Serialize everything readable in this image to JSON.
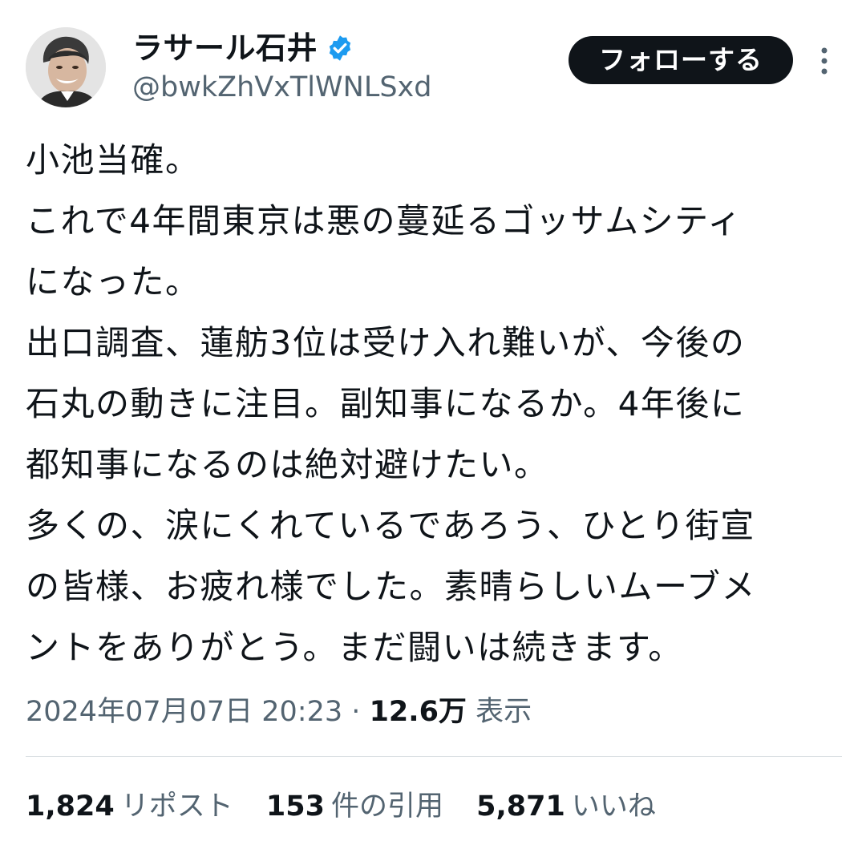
{
  "author": {
    "display_name": "ラサール石井",
    "handle": "@bwkZhVxTlWNLSxd",
    "verified_color": "#1d9bf0"
  },
  "actions": {
    "follow_label": "フォローする"
  },
  "tweet": {
    "lines": [
      "小池当確。",
      "これで4年間東京は悪の蔓延るゴッサムシティ",
      "になった。",
      "出口調査、蓮舫3位は受け入れ難いが、今後の",
      "石丸の動きに注目。副知事になるか。4年後に",
      "都知事になるのは絶対避けたい。",
      "多くの、涙にくれているであろう、ひとり街宣",
      "の皆様、お疲れ様でした。素晴らしいムーブメ",
      "ントをありがとう。まだ闘いは続きます。"
    ]
  },
  "meta": {
    "timestamp": "2024年07月07日 20:23",
    "separator": "·",
    "views_count": "12.6万",
    "views_label": "表示"
  },
  "stats": {
    "reposts_count": "1,824",
    "reposts_label": "リポスト",
    "quotes_count": "153",
    "quotes_label": "件の引用",
    "likes_count": "5,871",
    "likes_label": "いいね"
  },
  "colors": {
    "text_primary": "#0f1419",
    "text_secondary": "#536471",
    "button_bg": "#0f1419",
    "divider": "#d8dde1"
  }
}
